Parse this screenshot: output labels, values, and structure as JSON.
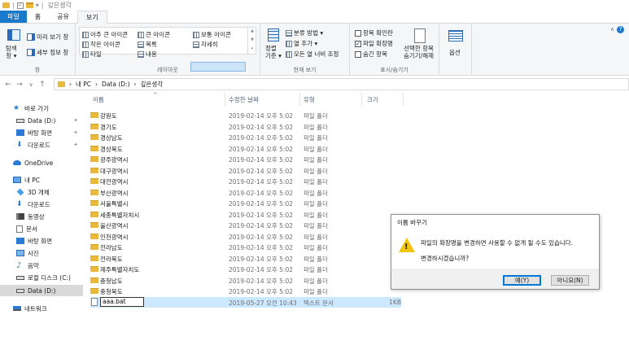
{
  "window": {
    "title": "깊은생각",
    "quick_access_sep": "|"
  },
  "tabs": [
    {
      "label": "파일"
    },
    {
      "label": "홈"
    },
    {
      "label": "공유"
    },
    {
      "label": "보기"
    }
  ],
  "ribbon": {
    "panes": {
      "nav_pane": "탐색\n창 ▾",
      "preview": "미리 보기 창",
      "details": "세부 정보 창",
      "label": "창"
    },
    "layout": {
      "items": [
        "아주 큰 아이콘",
        "큰 아이콘",
        "보통 아이콘",
        "작은 아이콘",
        "목록",
        "자세히",
        "타일",
        "내용"
      ],
      "label": "레이아웃"
    },
    "current_view": {
      "sort": "정렬\n기준 ▾",
      "group_by": "분류 방법 ▾",
      "add_column": "열 추가 ▾",
      "fit_columns": "모든 열 너비 조정",
      "label": "현재 보기"
    },
    "show_hide": {
      "item_checkboxes": "항목 확인란",
      "file_extensions": "파일 확장명",
      "hidden_items": "숨긴 항목",
      "hide_selected": "선택한 항목\n숨기기/해제",
      "label": "표시/숨기기"
    },
    "options": {
      "label": "옵션"
    }
  },
  "address": {
    "back": "←",
    "forward": "→",
    "recent": "∨",
    "up": "↑",
    "crumbs": [
      "내 PC",
      "Data (D:)",
      "깊은생각"
    ],
    "sep": "›"
  },
  "nav": {
    "quick_access": "바로 가기",
    "data_d_pinned": "Data (D:)",
    "desktop_pinned": "바탕 화면",
    "downloads_pinned": "다운로드",
    "onedrive": "OneDrive",
    "this_pc": "내 PC",
    "objects3d": "3D 개체",
    "downloads": "다운로드",
    "videos": "동영상",
    "documents": "문서",
    "desktop": "바탕 화면",
    "pictures": "사진",
    "music": "음악",
    "local_c": "로컬 디스크 (C:)",
    "data_d": "Data (D:)",
    "network": "네트워크"
  },
  "columns": {
    "name": "이름",
    "modified": "수정한 날짜",
    "type": "유형",
    "size": "크기"
  },
  "folders": [
    {
      "name": "강원도",
      "date": "2019-02-14 오후 5:02",
      "type": "파일 폴더"
    },
    {
      "name": "경기도",
      "date": "2019-02-14 오후 5:02",
      "type": "파일 폴더"
    },
    {
      "name": "경상남도",
      "date": "2019-02-14 오후 5:02",
      "type": "파일 폴더"
    },
    {
      "name": "경상북도",
      "date": "2019-02-14 오후 5:02",
      "type": "파일 폴더"
    },
    {
      "name": "광주광역시",
      "date": "2019-02-14 오후 5:02",
      "type": "파일 폴더"
    },
    {
      "name": "대구광역시",
      "date": "2019-02-14 오후 5:02",
      "type": "파일 폴더"
    },
    {
      "name": "대전광역시",
      "date": "2019-02-14 오후 5:02",
      "type": "파일 폴더"
    },
    {
      "name": "부산광역시",
      "date": "2019-02-14 오후 5:02",
      "type": "파일 폴더"
    },
    {
      "name": "서울특별시",
      "date": "2019-02-14 오후 5:02",
      "type": "파일 폴더"
    },
    {
      "name": "세종특별자치시",
      "date": "2019-02-14 오후 5:02",
      "type": "파일 폴더"
    },
    {
      "name": "울산광역시",
      "date": "2019-02-14 오후 5:02",
      "type": "파일 폴더"
    },
    {
      "name": "인천광역시",
      "date": "2019-02-14 오후 5:02",
      "type": "파일 폴더"
    },
    {
      "name": "전라남도",
      "date": "2019-02-14 오후 5:02",
      "type": "파일 폴더"
    },
    {
      "name": "전라북도",
      "date": "2019-02-14 오후 5:02",
      "type": "파일 폴더"
    },
    {
      "name": "제주특별자치도",
      "date": "2019-02-14 오후 5:02",
      "type": "파일 폴더"
    },
    {
      "name": "충청남도",
      "date": "2019-02-14 오후 5:02",
      "type": "파일 폴더"
    },
    {
      "name": "충청북도",
      "date": "2019-02-14 오후 5:02",
      "type": "파일 폴더"
    }
  ],
  "file": {
    "name_value": "aaa.bat",
    "date": "2019-05-27 오전 10:43",
    "type": "텍스트 문서",
    "size": "1KB"
  },
  "dialog": {
    "title": "이름 바꾸기",
    "message": "파일의 확장명을 변경하면 사용할 수 없게 될 수도 있습니다.",
    "question": "변경하시겠습니까?",
    "yes": "예(Y)",
    "no": "아니요(N)"
  }
}
